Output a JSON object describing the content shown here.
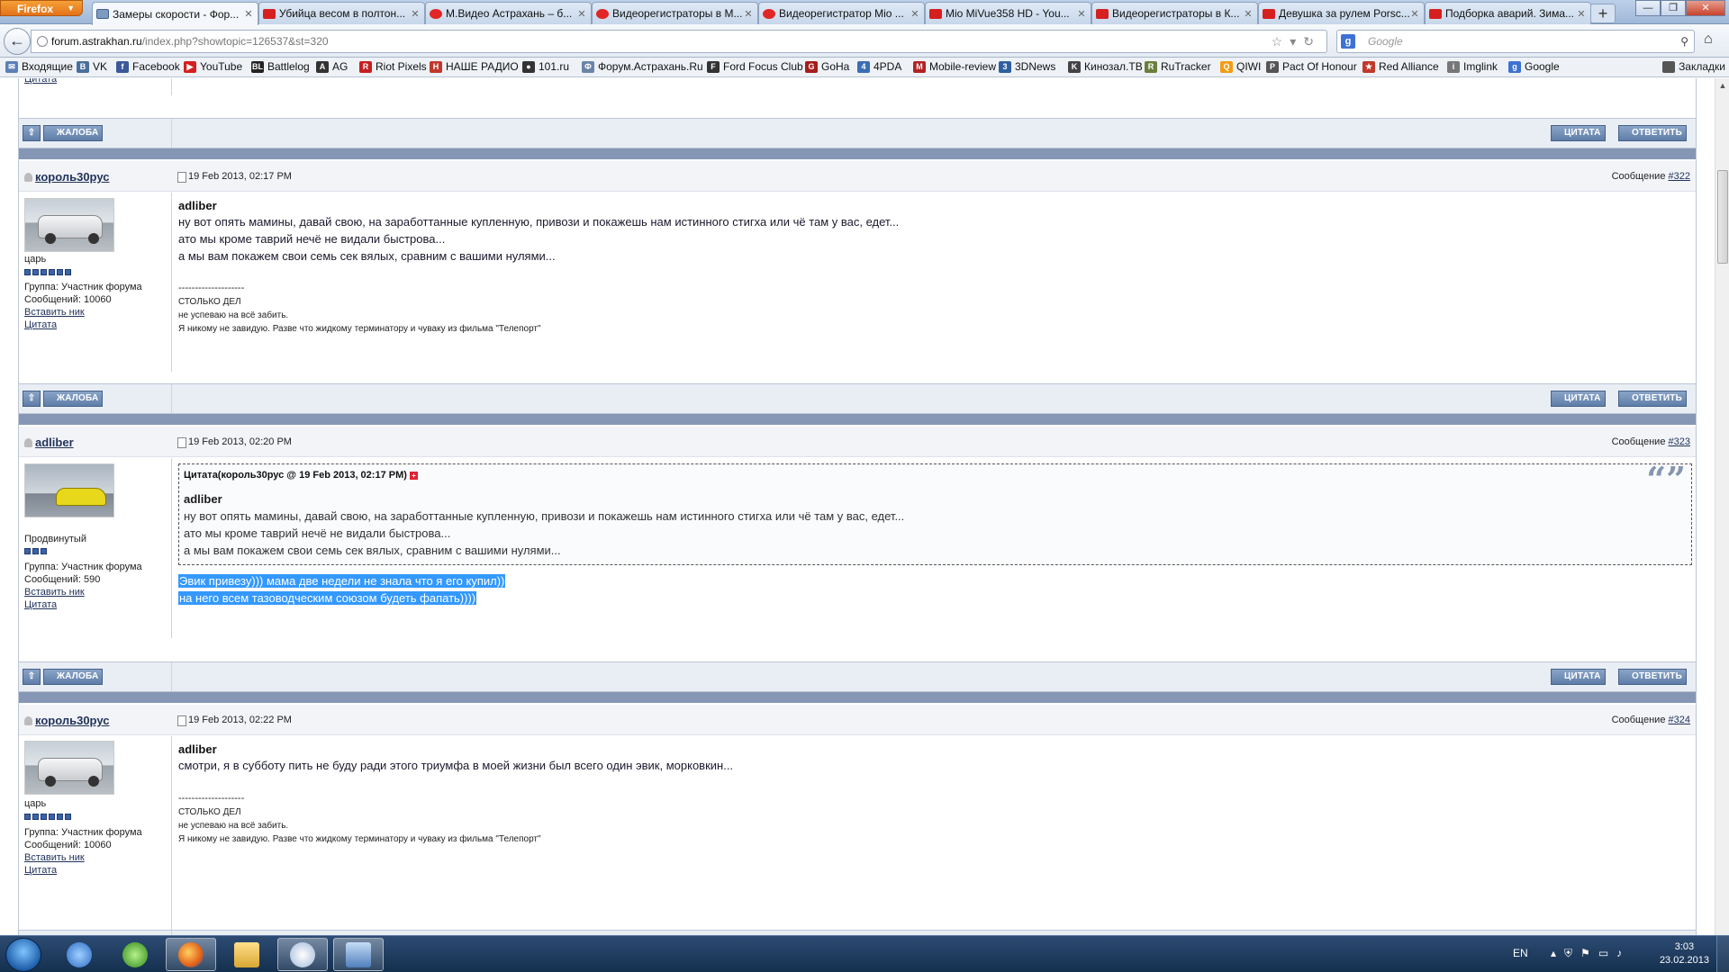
{
  "browser": {
    "menu_button": "Firefox",
    "tabs": [
      {
        "title": "Замеры скорости - Фор...",
        "favicon": "forum",
        "active": true
      },
      {
        "title": "Убийца весом в полтон...",
        "favicon": "youtube"
      },
      {
        "title": "М.Видео Астрахань – б...",
        "favicon": "mvideo"
      },
      {
        "title": "Видеорегистраторы в М...",
        "favicon": "mvideo"
      },
      {
        "title": "Видеорегистратор Mio ...",
        "favicon": "mvideo"
      },
      {
        "title": "Mio MiVue358 HD - You...",
        "favicon": "youtube"
      },
      {
        "title": "Видеорегистраторы в К...",
        "favicon": "youtube"
      },
      {
        "title": "Девушка за рулем Porsc...",
        "favicon": "youtube"
      },
      {
        "title": "Подборка аварий. Зима...",
        "favicon": "youtube"
      }
    ],
    "url_domain": "forum.astrakhan.ru",
    "url_path": "/index.php?showtopic=126537&st=320",
    "search_placeholder": "Google",
    "bookmarks": [
      {
        "label": "Входящие",
        "color": "#5d7fb8",
        "glyph": "✉"
      },
      {
        "label": "VK",
        "color": "#4a6f9d",
        "glyph": "B"
      },
      {
        "label": "Facebook",
        "color": "#3b5998",
        "glyph": "f"
      },
      {
        "label": "YouTube",
        "color": "#d61f1f",
        "glyph": "▶"
      },
      {
        "label": "Battlelog",
        "color": "#222222",
        "glyph": "BL"
      },
      {
        "label": "AG",
        "color": "#333333",
        "glyph": "A"
      },
      {
        "label": "Riot Pixels",
        "color": "#c62020",
        "glyph": "R"
      },
      {
        "label": "НАШЕ РАДИО",
        "color": "#c0392b",
        "glyph": "Н"
      },
      {
        "label": "101.ru",
        "color": "#333333",
        "glyph": "●"
      },
      {
        "label": "Форум.Астрахань.Ru",
        "color": "#6b84a8",
        "glyph": "Ф"
      },
      {
        "label": "Ford Focus Club",
        "color": "#333333",
        "glyph": "F"
      },
      {
        "label": "GoHa",
        "color": "#a61c1c",
        "glyph": "G"
      },
      {
        "label": "4PDA",
        "color": "#3a6eb5",
        "glyph": "4"
      },
      {
        "label": "Mobile-review",
        "color": "#b22222",
        "glyph": "M"
      },
      {
        "label": "3DNews",
        "color": "#2f5fa0",
        "glyph": "3"
      },
      {
        "label": "Кинозал.ТВ",
        "color": "#444444",
        "glyph": "K"
      },
      {
        "label": "RuTracker",
        "color": "#6a7f3a",
        "glyph": "R"
      },
      {
        "label": "QIWI",
        "color": "#f39c12",
        "glyph": "Q"
      },
      {
        "label": "Pact Of Honour",
        "color": "#555555",
        "glyph": "P"
      },
      {
        "label": "Red Alliance",
        "color": "#c0392b",
        "glyph": "★"
      },
      {
        "label": "Imglink",
        "color": "#777777",
        "glyph": "i"
      },
      {
        "label": "Google",
        "color": "#3d72d4",
        "glyph": "g"
      }
    ],
    "bookmarks_menu": "Закладки"
  },
  "forum": {
    "buttons": {
      "report": "ЖАЛОБА",
      "quote": "ЦИТАТА",
      "reply": "ОТВЕТИТЬ",
      "up": "⇧"
    },
    "message_label": "Сообщение",
    "user_links": {
      "insert_nick": "Вставить ник",
      "quote": "Цитата"
    },
    "top_fragment": "Цитата",
    "posts": [
      {
        "author": "король30рус",
        "date": "19 Feb 2013, 02:17 PM",
        "number": "#322",
        "rank": "царь",
        "pips": 6,
        "group": "Группа: Участник форума",
        "count": "Сообщений: 10060",
        "addressee": "adliber",
        "lines": [
          "ну вот опять мамины, давай свою, на заработтанные купленную, привози и покажешь нам истинного стигха или чё там у вас, едет...",
          "ато мы кроме таврий нечё не видали быстрова...",
          "а мы вам покажем свои семь сек вялых, сравним с вашими нулями..."
        ],
        "signature": [
          "--------------------",
          "СТОЛЬКО ДЕЛ",
          "не успеваю на всё забить.",
          "Я никому не завидую. Разве что жидкому терминатору и чуваку из фильма \"Телепорт\""
        ]
      },
      {
        "author": "adliber",
        "date": "19 Feb 2013, 02:20 PM",
        "number": "#323",
        "rank": "Продвинутый",
        "pips": 3,
        "group": "Группа: Участник форума",
        "count": "Сообщений: 590",
        "quote_header": "Цитата(король30рус @ 19 Feb 2013, 02:17 PM)",
        "quote_addressee": "adliber",
        "quote_lines": [
          "ну вот опять мамины, давай свою, на заработтанные купленную, привози и покажешь нам истинного стигха или чё там у вас, едет...",
          "ато мы кроме таврий нечё не видали быстрова...",
          "а мы вам покажем свои семь сек вялых, сравним с вашими нулями..."
        ],
        "selected_lines": [
          "Эвик привезу))) мама две недели не знала что я его купил))",
          "на него всем тазоводческим союзом будеть фапать))))"
        ]
      },
      {
        "author": "король30рус",
        "date": "19 Feb 2013, 02:22 PM",
        "number": "#324",
        "rank": "царь",
        "pips": 6,
        "group": "Группа: Участник форума",
        "count": "Сообщений: 10060",
        "addressee": "adliber",
        "lines": [
          "смотри, я в субботу пить не буду ради этого триумфа в моей жизни был всего один эвик, морковкин..."
        ],
        "signature": [
          "--------------------",
          "СТОЛЬКО ДЕЛ",
          "не успеваю на всё забить.",
          "Я никому не завидую. Разве что жидкому терминатору и чуваку из фильма \"Телепорт\""
        ]
      }
    ]
  },
  "taskbar": {
    "apps": [
      "windows-live-messenger",
      "utorrent",
      "firefox",
      "explorer",
      "paint",
      "remote-desktop"
    ],
    "language": "EN",
    "time": "3:03",
    "date": "23.02.2013"
  }
}
